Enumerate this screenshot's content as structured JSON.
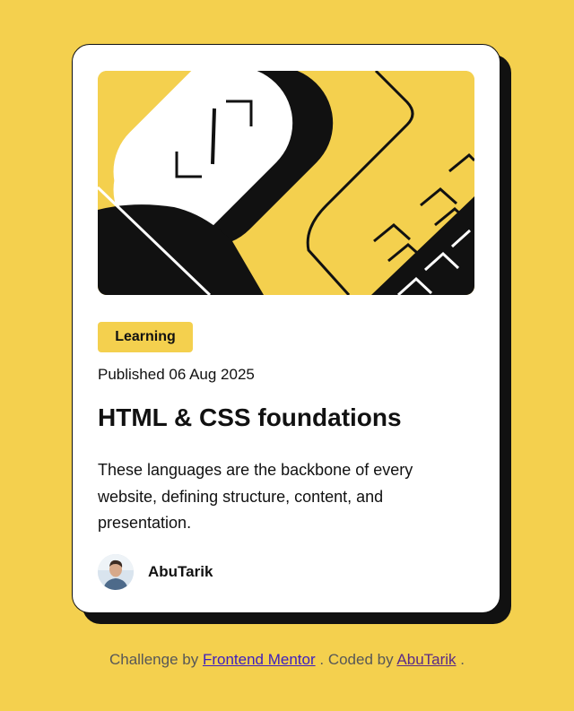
{
  "card": {
    "category": "Learning",
    "published": "Published 06 Aug 2025",
    "title": "HTML & CSS foundations",
    "description": "These languages are the backbone of every website, defining structure, content, and presentation.",
    "author": "AbuTarik"
  },
  "attribution": {
    "prefix": "Challenge by",
    "challenge_link": "Frontend Mentor",
    "middle": ". Coded by",
    "coder_link": "AbuTarik",
    "suffix": "."
  },
  "colors": {
    "background": "#f4d04e",
    "card": "#ffffff",
    "ink": "#111111",
    "link": "#3c1ebf"
  },
  "icons": {
    "hero": "illustration-article",
    "avatar": "avatar-photo"
  }
}
